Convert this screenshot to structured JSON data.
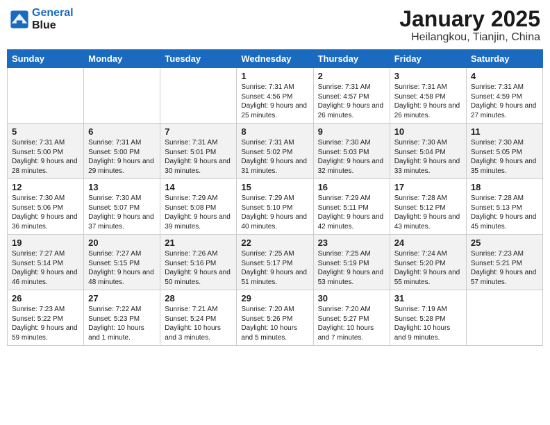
{
  "header": {
    "logo_line1": "General",
    "logo_line2": "Blue",
    "month_title": "January 2025",
    "location": "Heilangkou, Tianjin, China"
  },
  "weekdays": [
    "Sunday",
    "Monday",
    "Tuesday",
    "Wednesday",
    "Thursday",
    "Friday",
    "Saturday"
  ],
  "weeks": [
    [
      {
        "day": "",
        "info": ""
      },
      {
        "day": "",
        "info": ""
      },
      {
        "day": "",
        "info": ""
      },
      {
        "day": "1",
        "info": "Sunrise: 7:31 AM\nSunset: 4:56 PM\nDaylight: 9 hours\nand 25 minutes."
      },
      {
        "day": "2",
        "info": "Sunrise: 7:31 AM\nSunset: 4:57 PM\nDaylight: 9 hours\nand 26 minutes."
      },
      {
        "day": "3",
        "info": "Sunrise: 7:31 AM\nSunset: 4:58 PM\nDaylight: 9 hours\nand 26 minutes."
      },
      {
        "day": "4",
        "info": "Sunrise: 7:31 AM\nSunset: 4:59 PM\nDaylight: 9 hours\nand 27 minutes."
      }
    ],
    [
      {
        "day": "5",
        "info": "Sunrise: 7:31 AM\nSunset: 5:00 PM\nDaylight: 9 hours\nand 28 minutes."
      },
      {
        "day": "6",
        "info": "Sunrise: 7:31 AM\nSunset: 5:00 PM\nDaylight: 9 hours\nand 29 minutes."
      },
      {
        "day": "7",
        "info": "Sunrise: 7:31 AM\nSunset: 5:01 PM\nDaylight: 9 hours\nand 30 minutes."
      },
      {
        "day": "8",
        "info": "Sunrise: 7:31 AM\nSunset: 5:02 PM\nDaylight: 9 hours\nand 31 minutes."
      },
      {
        "day": "9",
        "info": "Sunrise: 7:30 AM\nSunset: 5:03 PM\nDaylight: 9 hours\nand 32 minutes."
      },
      {
        "day": "10",
        "info": "Sunrise: 7:30 AM\nSunset: 5:04 PM\nDaylight: 9 hours\nand 33 minutes."
      },
      {
        "day": "11",
        "info": "Sunrise: 7:30 AM\nSunset: 5:05 PM\nDaylight: 9 hours\nand 35 minutes."
      }
    ],
    [
      {
        "day": "12",
        "info": "Sunrise: 7:30 AM\nSunset: 5:06 PM\nDaylight: 9 hours\nand 36 minutes."
      },
      {
        "day": "13",
        "info": "Sunrise: 7:30 AM\nSunset: 5:07 PM\nDaylight: 9 hours\nand 37 minutes."
      },
      {
        "day": "14",
        "info": "Sunrise: 7:29 AM\nSunset: 5:08 PM\nDaylight: 9 hours\nand 39 minutes."
      },
      {
        "day": "15",
        "info": "Sunrise: 7:29 AM\nSunset: 5:10 PM\nDaylight: 9 hours\nand 40 minutes."
      },
      {
        "day": "16",
        "info": "Sunrise: 7:29 AM\nSunset: 5:11 PM\nDaylight: 9 hours\nand 42 minutes."
      },
      {
        "day": "17",
        "info": "Sunrise: 7:28 AM\nSunset: 5:12 PM\nDaylight: 9 hours\nand 43 minutes."
      },
      {
        "day": "18",
        "info": "Sunrise: 7:28 AM\nSunset: 5:13 PM\nDaylight: 9 hours\nand 45 minutes."
      }
    ],
    [
      {
        "day": "19",
        "info": "Sunrise: 7:27 AM\nSunset: 5:14 PM\nDaylight: 9 hours\nand 46 minutes."
      },
      {
        "day": "20",
        "info": "Sunrise: 7:27 AM\nSunset: 5:15 PM\nDaylight: 9 hours\nand 48 minutes."
      },
      {
        "day": "21",
        "info": "Sunrise: 7:26 AM\nSunset: 5:16 PM\nDaylight: 9 hours\nand 50 minutes."
      },
      {
        "day": "22",
        "info": "Sunrise: 7:25 AM\nSunset: 5:17 PM\nDaylight: 9 hours\nand 51 minutes."
      },
      {
        "day": "23",
        "info": "Sunrise: 7:25 AM\nSunset: 5:19 PM\nDaylight: 9 hours\nand 53 minutes."
      },
      {
        "day": "24",
        "info": "Sunrise: 7:24 AM\nSunset: 5:20 PM\nDaylight: 9 hours\nand 55 minutes."
      },
      {
        "day": "25",
        "info": "Sunrise: 7:23 AM\nSunset: 5:21 PM\nDaylight: 9 hours\nand 57 minutes."
      }
    ],
    [
      {
        "day": "26",
        "info": "Sunrise: 7:23 AM\nSunset: 5:22 PM\nDaylight: 9 hours\nand 59 minutes."
      },
      {
        "day": "27",
        "info": "Sunrise: 7:22 AM\nSunset: 5:23 PM\nDaylight: 10 hours\nand 1 minute."
      },
      {
        "day": "28",
        "info": "Sunrise: 7:21 AM\nSunset: 5:24 PM\nDaylight: 10 hours\nand 3 minutes."
      },
      {
        "day": "29",
        "info": "Sunrise: 7:20 AM\nSunset: 5:26 PM\nDaylight: 10 hours\nand 5 minutes."
      },
      {
        "day": "30",
        "info": "Sunrise: 7:20 AM\nSunset: 5:27 PM\nDaylight: 10 hours\nand 7 minutes."
      },
      {
        "day": "31",
        "info": "Sunrise: 7:19 AM\nSunset: 5:28 PM\nDaylight: 10 hours\nand 9 minutes."
      },
      {
        "day": "",
        "info": ""
      }
    ]
  ]
}
